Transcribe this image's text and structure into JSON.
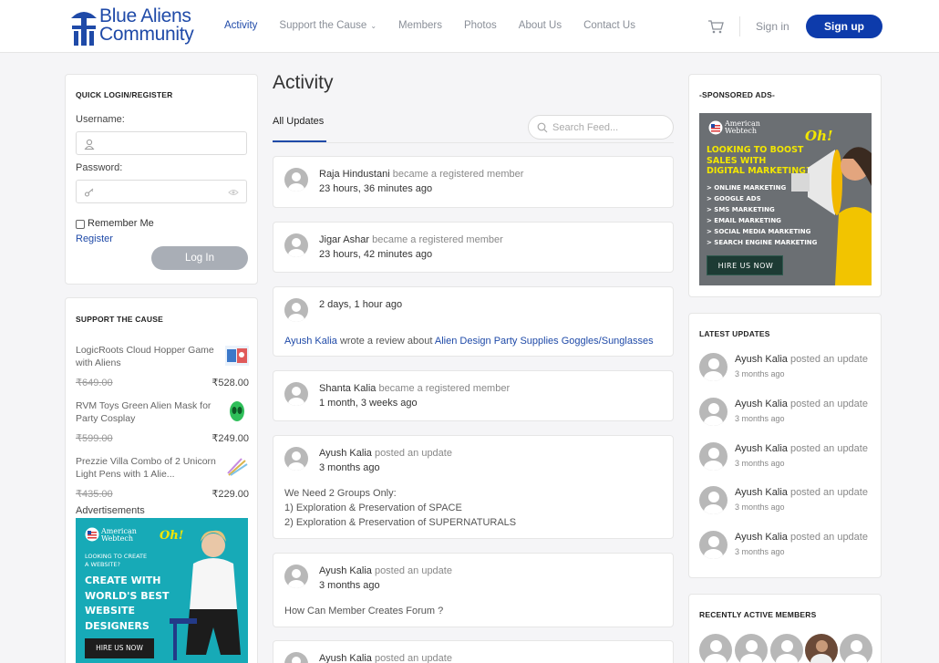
{
  "header": {
    "logo_line1": "Blue Aliens",
    "logo_line2": "Community",
    "nav": [
      {
        "label": "Activity"
      },
      {
        "label": "Support the Cause"
      },
      {
        "label": "Members"
      },
      {
        "label": "Photos"
      },
      {
        "label": "About Us"
      },
      {
        "label": "Contact Us"
      }
    ],
    "signin": "Sign in",
    "signup": "Sign up"
  },
  "login": {
    "title": "QUICK LOGIN/REGISTER",
    "username_label": "Username:",
    "password_label": "Password:",
    "remember": "Remember Me",
    "register": "Register",
    "login_button": "Log In"
  },
  "support": {
    "title": "SUPPORT THE CAUSE",
    "products": [
      {
        "name": "LogicRoots Cloud Hopper Game with Aliens",
        "old_price": "₹649.00",
        "price": "₹528.00"
      },
      {
        "name": "RVM Toys Green Alien Mask for Party Cosplay",
        "old_price": "₹599.00",
        "price": "₹249.00"
      },
      {
        "name": "Prezzie Villa Combo of 2 Unicorn Light Pens with 1 Alie...",
        "old_price": "₹435.00",
        "price": "₹229.00"
      }
    ],
    "ads_label": "Advertisements",
    "ad": {
      "brand1": "American",
      "brand2": "Webtech",
      "oh": "Oh!",
      "line1": "LOOKING TO CREATE",
      "line2": "A WEBSITE?",
      "big1": "CREATE WITH",
      "big2": "WORLD'S BEST",
      "big3": "WEBSITE",
      "big4": "DESIGNERS",
      "cta": "HIRE US NOW"
    }
  },
  "feed": {
    "title": "Activity",
    "tab": "All Updates",
    "search_placeholder": "Search Feed...",
    "posts": [
      {
        "name": "Raja Hindustani",
        "action": " became a registered member",
        "time": "23 hours, 36 minutes ago"
      },
      {
        "name": "Jigar Ashar",
        "action": " became a registered member",
        "time": "23 hours, 42 minutes ago"
      },
      {
        "time": "2 days, 1 hour ago",
        "body_name": "Ayush Kalia",
        "body_mid": " wrote a review about ",
        "body_link": "Alien Design Party Supplies Goggles/Sunglasses"
      },
      {
        "name": "Shanta Kalia",
        "action": " became a registered member",
        "time": "1 month, 3 weeks ago"
      },
      {
        "name": "Ayush Kalia",
        "action": " posted an update",
        "time": "3 months ago",
        "lines": [
          "We Need 2 Groups Only:",
          "1) Exploration & Preservation of SPACE",
          "2) Exploration & Preservation of SUPERNATURALS"
        ]
      },
      {
        "name": "Ayush Kalia",
        "action": " posted an update",
        "time": "3 months ago",
        "lines": [
          "How Can Member Creates Forum ?"
        ]
      },
      {
        "name": "Ayush Kalia",
        "action": " posted an update"
      }
    ]
  },
  "sponsored": {
    "title": "-SPONSORED ADS-",
    "ad": {
      "brand1": "American",
      "brand2": "Webtech",
      "oh": "Oh!",
      "head1": "LOOKING TO BOOST",
      "head2": "SALES WITH",
      "head3": "DIGITAL MARKETING?",
      "items": [
        "> ONLINE MARKETING",
        "> GOOGLE ADS",
        "> SMS MARKETING",
        "> EMAIL MARKETING",
        "> SOCIAL MEDIA MARKETING",
        "> SEARCH ENGINE MARKETING"
      ],
      "cta": "HIRE US NOW"
    }
  },
  "latest": {
    "title": "LATEST UPDATES",
    "items": [
      {
        "name": "Ayush Kalia",
        "action": " posted an update",
        "time": "3 months ago"
      },
      {
        "name": "Ayush Kalia",
        "action": " posted an update",
        "time": "3 months ago"
      },
      {
        "name": "Ayush Kalia",
        "action": " posted an update",
        "time": "3 months ago"
      },
      {
        "name": "Ayush Kalia",
        "action": " posted an update",
        "time": "3 months ago"
      },
      {
        "name": "Ayush Kalia",
        "action": " posted an update",
        "time": "3 months ago"
      }
    ]
  },
  "recent": {
    "title": "RECENTLY ACTIVE MEMBERS"
  },
  "colors": {
    "brand": "#1f4aa8",
    "signup_bg": "#0d3bab",
    "ad_teal": "#17aab7",
    "ad_yellow": "#f2e600"
  }
}
